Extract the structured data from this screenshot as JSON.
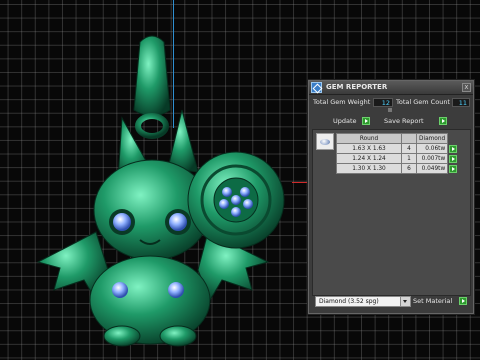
{
  "viewport": {
    "background": "#080808",
    "grid_color": "#969696"
  },
  "gem_reporter": {
    "title": "GEM REPORTER",
    "close_glyph": "x",
    "total_gem_weight_label": "Total Gem Weight",
    "total_gem_weight_value": "12",
    "total_gem_count_label": "Total Gem Count",
    "total_gem_count_value": "11",
    "update_label": "Update",
    "save_report_label": "Save Report",
    "table": {
      "headers": [
        "Round",
        "",
        "Diamond"
      ],
      "rows": [
        {
          "size": "1.63 X 1.63",
          "count": "4",
          "weight": "0.06tw"
        },
        {
          "size": "1.24 X 1.24",
          "count": "1",
          "weight": "0.007tw"
        },
        {
          "size": "1.30 X 1.30",
          "count": "6",
          "weight": "0.049tw"
        }
      ]
    },
    "material_select": "Diamond (3.52 spg)",
    "set_material_label": "Set Material"
  },
  "colors": {
    "accent_value": "#4fd2ff",
    "go_button": "#2e9a2e",
    "model_green": "#1f8f62"
  },
  "icons": [
    "gem-reporter-app-icon",
    "close-icon",
    "go-arrow-icon",
    "round-diamond-icon",
    "dropdown-arrow-icon"
  ]
}
